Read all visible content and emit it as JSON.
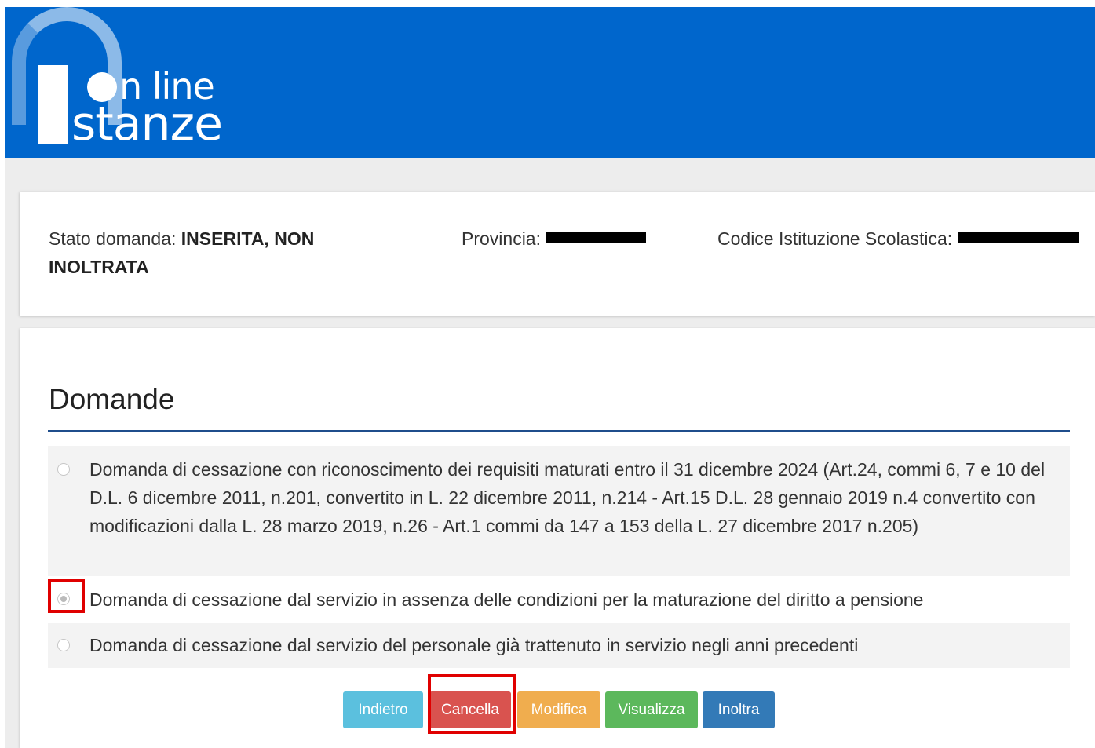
{
  "header": {
    "logo_line1": "n line",
    "logo_line2": "stanze"
  },
  "status": {
    "stato_label": "Stato domanda: ",
    "stato_value": "INSERITA, NON INOLTRATA",
    "provincia_label": "Provincia: ",
    "codice_label": "Codice Istituzione Scolastica: "
  },
  "domande": {
    "title": "Domande",
    "options": [
      {
        "label": "Domanda di cessazione con riconoscimento dei requisiti maturati entro il 31 dicembre 2024 (Art.24, commi 6, 7 e 10 del D.L. 6 dicembre 2011, n.201, convertito in L. 22 dicembre 2011, n.214 - Art.15 D.L. 28 gennaio 2019 n.4 convertito con modificazioni dalla L. 28 marzo 2019, n.26 - Art.1 commi da 147 a 153 della L. 27 dicembre 2017 n.205)",
        "selected": false
      },
      {
        "label": "Domanda di cessazione dal servizio in assenza delle condizioni per la maturazione del diritto a pensione",
        "selected": true
      },
      {
        "label": "Domanda di cessazione dal servizio del personale già trattenuto in servizio negli anni precedenti",
        "selected": false
      }
    ]
  },
  "buttons": {
    "indietro": "Indietro",
    "cancella": "Cancella",
    "modifica": "Modifica",
    "visualizza": "Visualizza",
    "inoltra": "Inoltra"
  },
  "colors": {
    "header_blue": "#0066cc",
    "highlight_red": "#e00000",
    "btn_indietro": "#5bc0de",
    "btn_cancella": "#d9534f",
    "btn_modifica": "#f0ad4e",
    "btn_visualizza": "#5cb85c",
    "btn_inoltra": "#337ab7"
  }
}
